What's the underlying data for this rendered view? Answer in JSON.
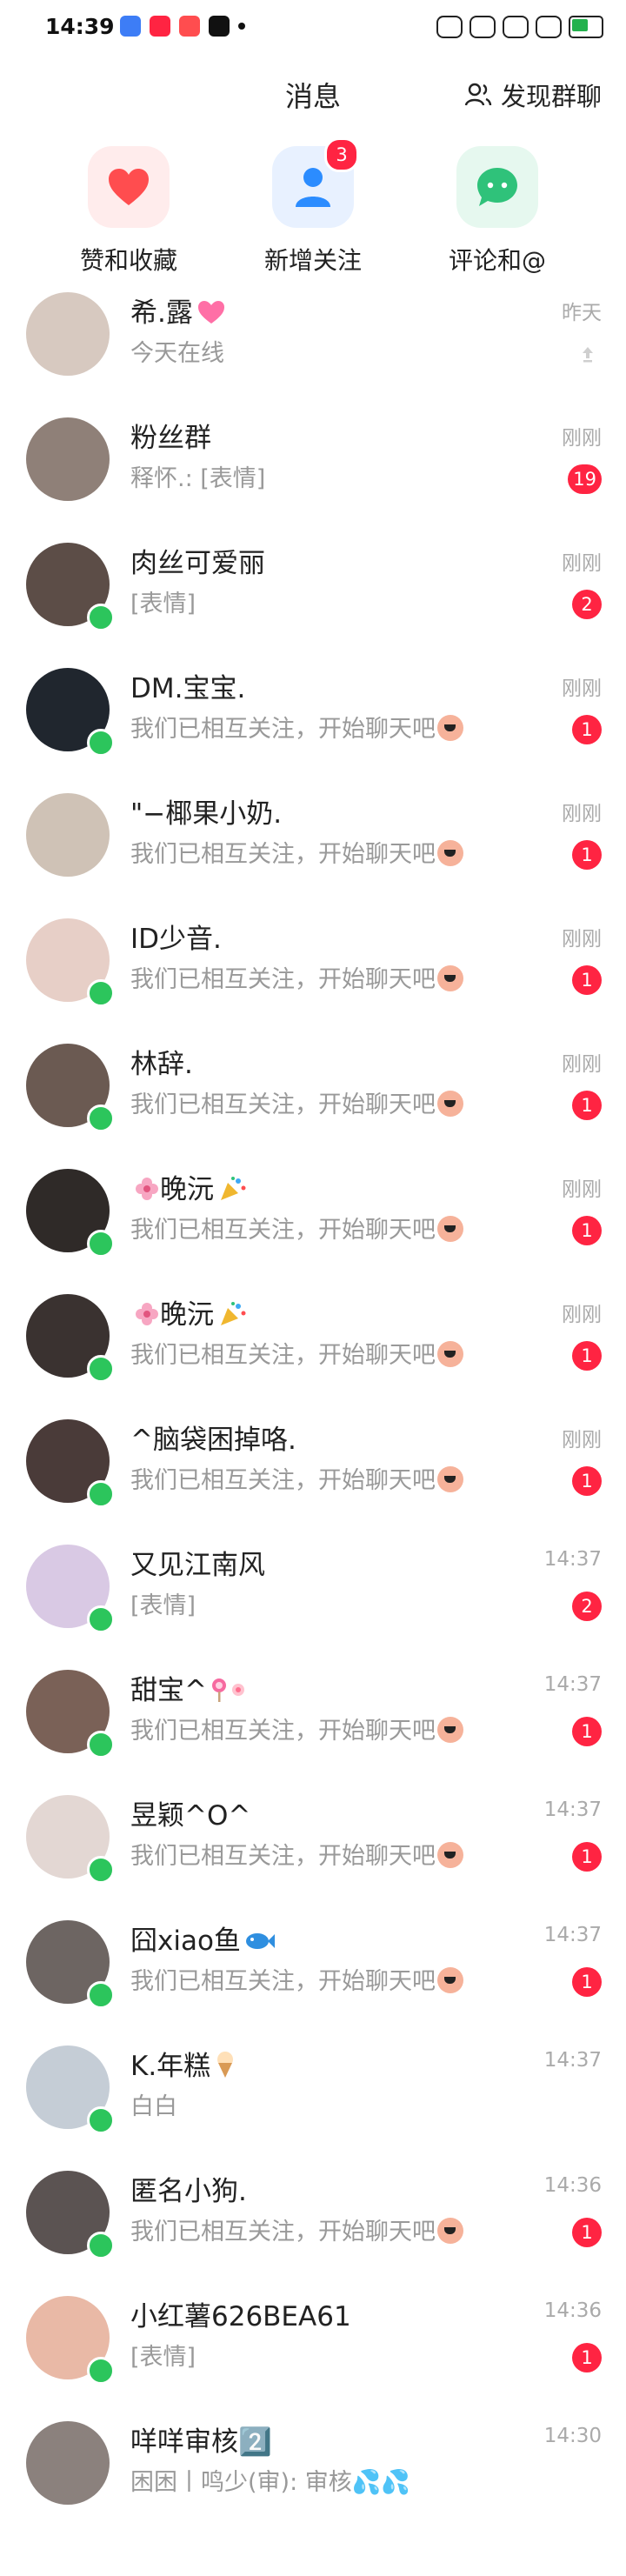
{
  "status_bar": {
    "time": "14:39"
  },
  "header": {
    "title": "消息",
    "discover_label": "发现群聊"
  },
  "shortcuts": [
    {
      "label": "赞和收藏",
      "icon": "heart-icon",
      "color": "#ff4d4f",
      "tint": "#ffecec"
    },
    {
      "label": "新增关注",
      "icon": "person-icon",
      "color": "#2b8cff",
      "tint": "#e8f1ff",
      "badge": "3"
    },
    {
      "label": "评论和@",
      "icon": "chat-bubble-icon",
      "color": "#2fc27a",
      "tint": "#e6f8ef"
    }
  ],
  "conversations": [
    {
      "name": "希.露",
      "name_emoji": "heart-icon",
      "preview": "今天在线",
      "time": "昨天",
      "badge": "",
      "muted": true,
      "online": false,
      "avatar_color": "#d7c9c0"
    },
    {
      "name": "粉丝群",
      "preview": "释怀.: [表情]",
      "time": "刚刚",
      "badge": "19",
      "online": false,
      "avatar_color": "#8f8078"
    },
    {
      "name": "肉丝可爱丽",
      "preview": "[表情]",
      "time": "刚刚",
      "badge": "2",
      "online": true,
      "avatar_color": "#5c4d47"
    },
    {
      "name": "DM.宝宝.",
      "preview": "我们已相互关注，开始聊天吧",
      "peach": true,
      "time": "刚刚",
      "badge": "1",
      "online": true,
      "avatar_color": "#20262e"
    },
    {
      "name": "\"−椰果小奶.",
      "preview": "我们已相互关注，开始聊天吧",
      "peach": true,
      "time": "刚刚",
      "badge": "1",
      "online": false,
      "avatar_color": "#cfc2b6"
    },
    {
      "name": "ID少音.",
      "preview": "我们已相互关注，开始聊天吧",
      "peach": true,
      "time": "刚刚",
      "badge": "1",
      "online": true,
      "avatar_color": "#e7cfc7"
    },
    {
      "name": "林辞.",
      "preview": "我们已相互关注，开始聊天吧",
      "peach": true,
      "time": "刚刚",
      "badge": "1",
      "online": true,
      "avatar_color": "#6b5a52"
    },
    {
      "name": "晚沅",
      "name_prefix": "flower-icon",
      "name_emoji": "confetti-icon",
      "preview": "我们已相互关注，开始聊天吧",
      "peach": true,
      "time": "刚刚",
      "badge": "1",
      "online": true,
      "avatar_color": "#2f2a28"
    },
    {
      "name": "晚沅",
      "name_prefix": "flower-icon",
      "name_emoji": "confetti-icon",
      "preview": "我们已相互关注，开始聊天吧",
      "peach": true,
      "time": "刚刚",
      "badge": "1",
      "online": true,
      "avatar_color": "#3a3230"
    },
    {
      "name": "^脑袋困掉咯.",
      "preview": "我们已相互关注，开始聊天吧",
      "peach": true,
      "time": "刚刚",
      "badge": "1",
      "online": true,
      "avatar_color": "#4a3b39"
    },
    {
      "name": "又见江南风",
      "preview": "[表情]",
      "time": "14:37",
      "badge": "2",
      "online": true,
      "avatar_color": "#d9c9e4"
    },
    {
      "name": "甜宝^",
      "name_emoji": "lollipop-icon",
      "preview": "我们已相互关注，开始聊天吧",
      "peach": true,
      "time": "14:37",
      "badge": "1",
      "online": true,
      "avatar_color": "#7a6157"
    },
    {
      "name": "昱颖^O^",
      "preview": "我们已相互关注，开始聊天吧",
      "peach": true,
      "time": "14:37",
      "badge": "1",
      "online": true,
      "avatar_color": "#e3d7d3"
    },
    {
      "name": "囧xiao鱼",
      "name_emoji": "fish-icon",
      "preview": "我们已相互关注，开始聊天吧",
      "peach": true,
      "time": "14:37",
      "badge": "1",
      "online": true,
      "avatar_color": "#6d6562"
    },
    {
      "name": "K.年糕",
      "name_emoji": "ice-cream-icon",
      "preview": "白白",
      "time": "14:37",
      "badge": "",
      "online": true,
      "avatar_color": "#c5cdd6"
    },
    {
      "name": "匿名小狗.",
      "preview": "我们已相互关注，开始聊天吧",
      "peach": true,
      "time": "14:36",
      "badge": "1",
      "online": true,
      "avatar_color": "#5b5352"
    },
    {
      "name": "小红薯626BEA61",
      "preview": "[表情]",
      "time": "14:36",
      "badge": "1",
      "online": true,
      "avatar_color": "#e9b9a6"
    },
    {
      "name": "咩咩审核2️⃣",
      "preview": "困困丨鸣少(审): 审核💦💦",
      "time": "14:30",
      "badge": "",
      "online": false,
      "avatar_color": "#8b817d"
    }
  ],
  "colors": {
    "accent": "#ff2442",
    "online": "#2cc55c"
  }
}
